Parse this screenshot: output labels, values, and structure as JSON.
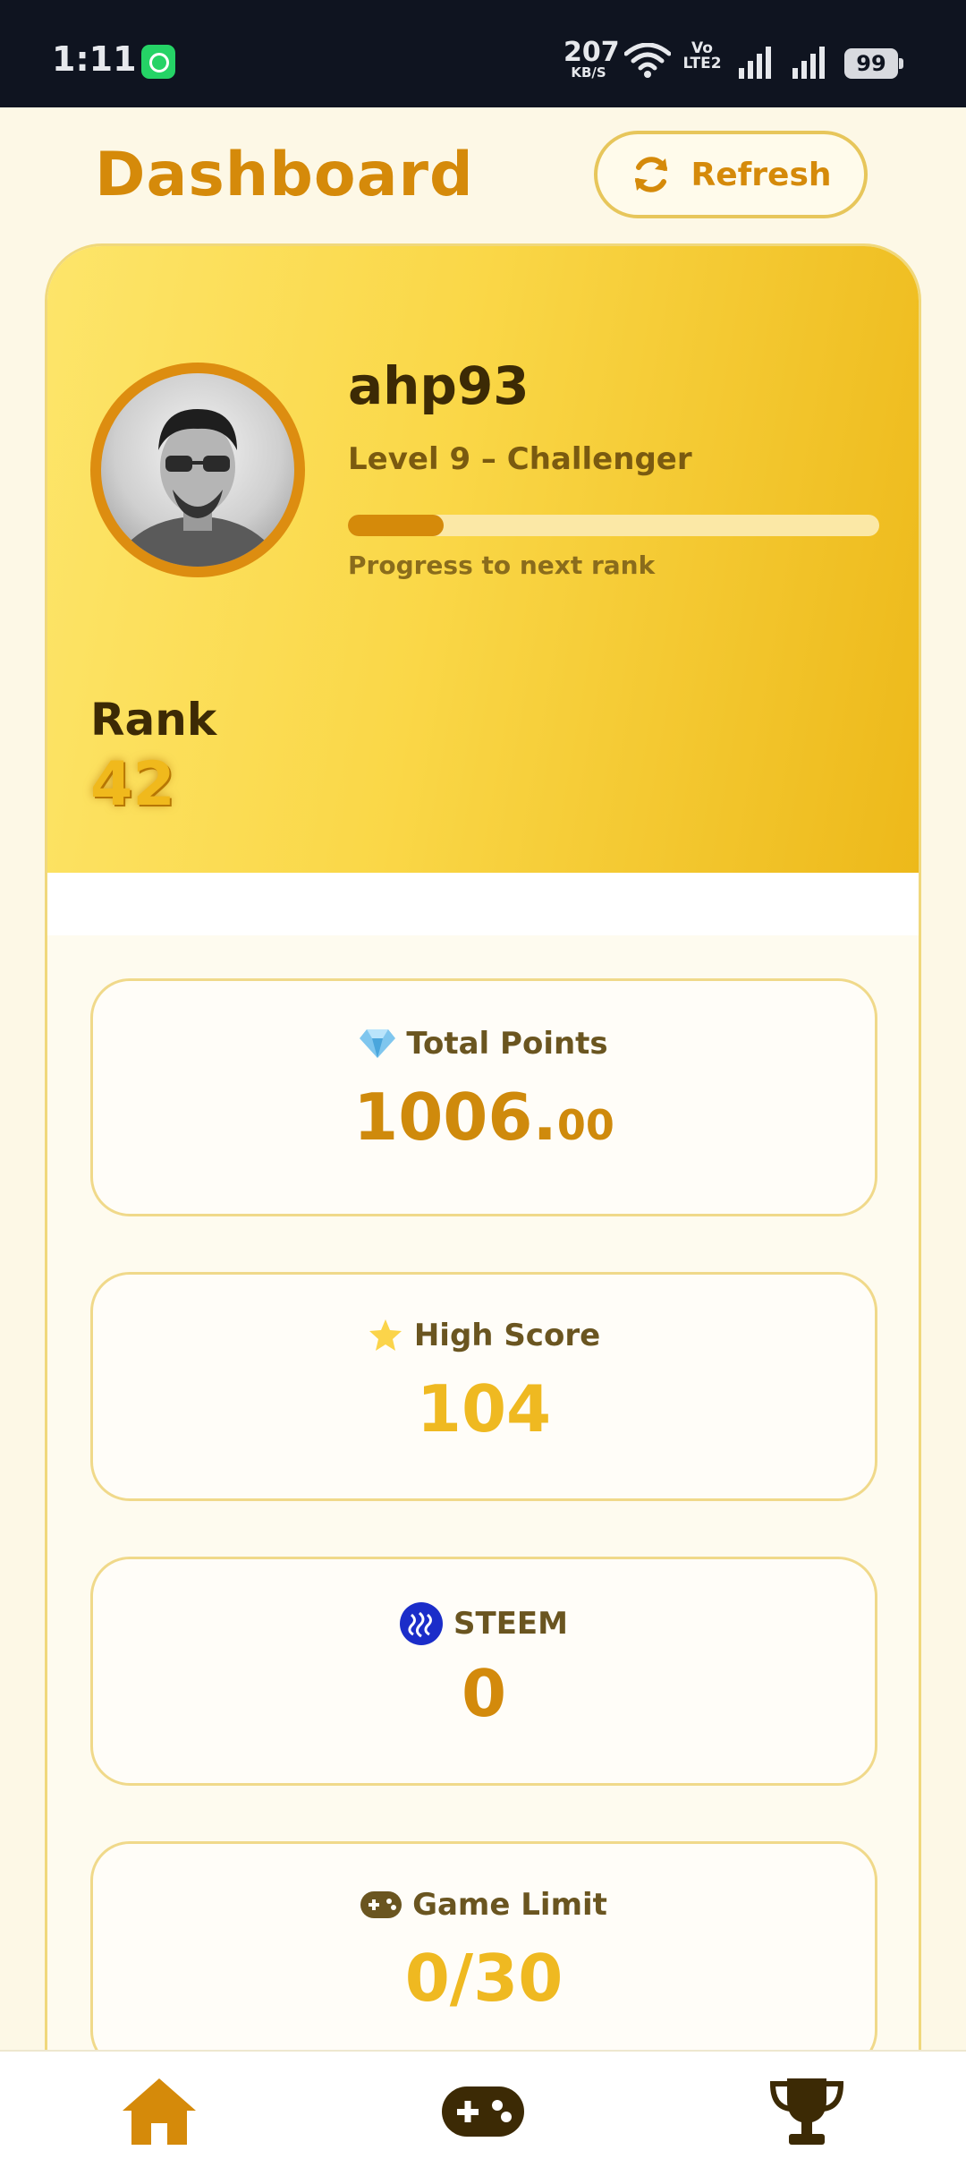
{
  "status_bar": {
    "time": "1:11",
    "net_speed": "207",
    "net_unit": "KB/S",
    "volte_top": "Vo",
    "volte_bottom": "LTE2",
    "battery": "99",
    "icons": [
      "whatsapp-icon",
      "wifi-icon",
      "volte-icon",
      "signal-icon",
      "signal-icon",
      "battery-icon"
    ]
  },
  "header": {
    "title": "Dashboard",
    "refresh_label": "Refresh",
    "refresh_icon": "sync-icon"
  },
  "profile": {
    "username": "ahp93",
    "level": "Level 9 – Challenger",
    "progress_fraction": 0.18,
    "progress_label": "Progress to next rank",
    "rank_label": "Rank",
    "rank_value": "42"
  },
  "stats": [
    {
      "icon": "gem-icon",
      "label": "Total Points",
      "value_main": "1006.",
      "value_decimal": "00",
      "color": "#cf8a0c"
    },
    {
      "icon": "star-icon",
      "label": "High Score",
      "value_main": "104",
      "color": "#efb921"
    },
    {
      "icon": "steem-icon",
      "label": "STEEM",
      "value_main": "0",
      "color": "#d38a0c"
    },
    {
      "icon": "gamepad-icon",
      "label": "Game Limit",
      "value_main": "0/30",
      "color": "#efb921"
    }
  ],
  "colors": {
    "accent": "#d58a0a",
    "gold": "#f0b91c",
    "background": "#fdf8e6",
    "dark": "#3c2a05"
  },
  "bottom_nav": {
    "items": [
      "home-icon",
      "gamepad-icon",
      "trophy-icon"
    ],
    "active": "home-icon"
  }
}
